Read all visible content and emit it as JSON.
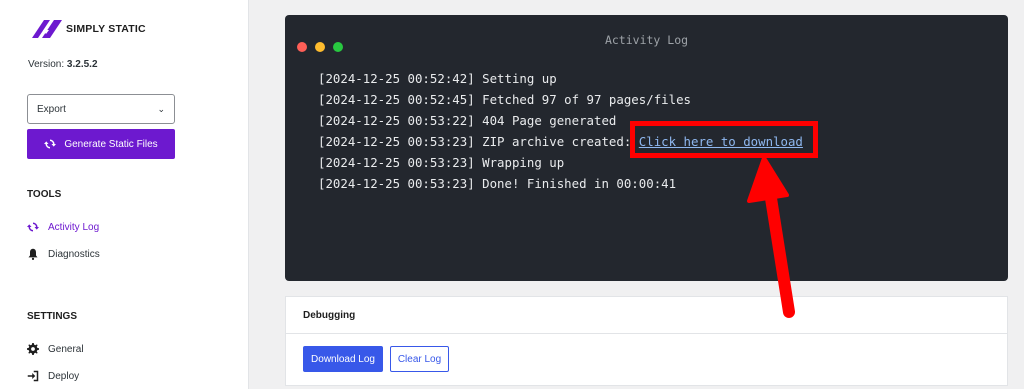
{
  "sidebar": {
    "brand": "SIMPLY STATIC",
    "version_label": "Version:",
    "version_value": "3.2.5.2",
    "export_select": {
      "selected": "Export"
    },
    "generate_button": "Generate Static Files",
    "tools_title": "TOOLS",
    "tools": [
      {
        "label": "Activity Log",
        "icon": "refresh-icon",
        "active": true
      },
      {
        "label": "Diagnostics",
        "icon": "bell-icon",
        "active": false
      }
    ],
    "settings_title": "SETTINGS",
    "settings": [
      {
        "label": "General",
        "icon": "gear-icon"
      },
      {
        "label": "Deploy",
        "icon": "sign-in-icon"
      }
    ]
  },
  "terminal": {
    "title": "Activity Log",
    "lines": [
      "[2024-12-25 00:52:42] Setting up",
      "[2024-12-25 00:52:45] Fetched 97 of 97 pages/files",
      "[2024-12-25 00:53:22] 404 Page generated",
      "[2024-12-25 00:53:23] ZIP archive created: ",
      "[2024-12-25 00:53:23] Wrapping up",
      "[2024-12-25 00:53:23] Done! Finished in 00:00:41"
    ],
    "download_link": "Click here to download"
  },
  "debugging": {
    "title": "Debugging",
    "download_log": "Download Log",
    "clear_log": "Clear Log"
  },
  "colors": {
    "brand_purple": "#6d19cf",
    "primary_blue": "#3858e9",
    "terminal_bg": "#23272e",
    "annotation_red": "#ff0000",
    "dot_red": "#ff5f57",
    "dot_yellow": "#febc2e",
    "dot_green": "#28c840"
  }
}
